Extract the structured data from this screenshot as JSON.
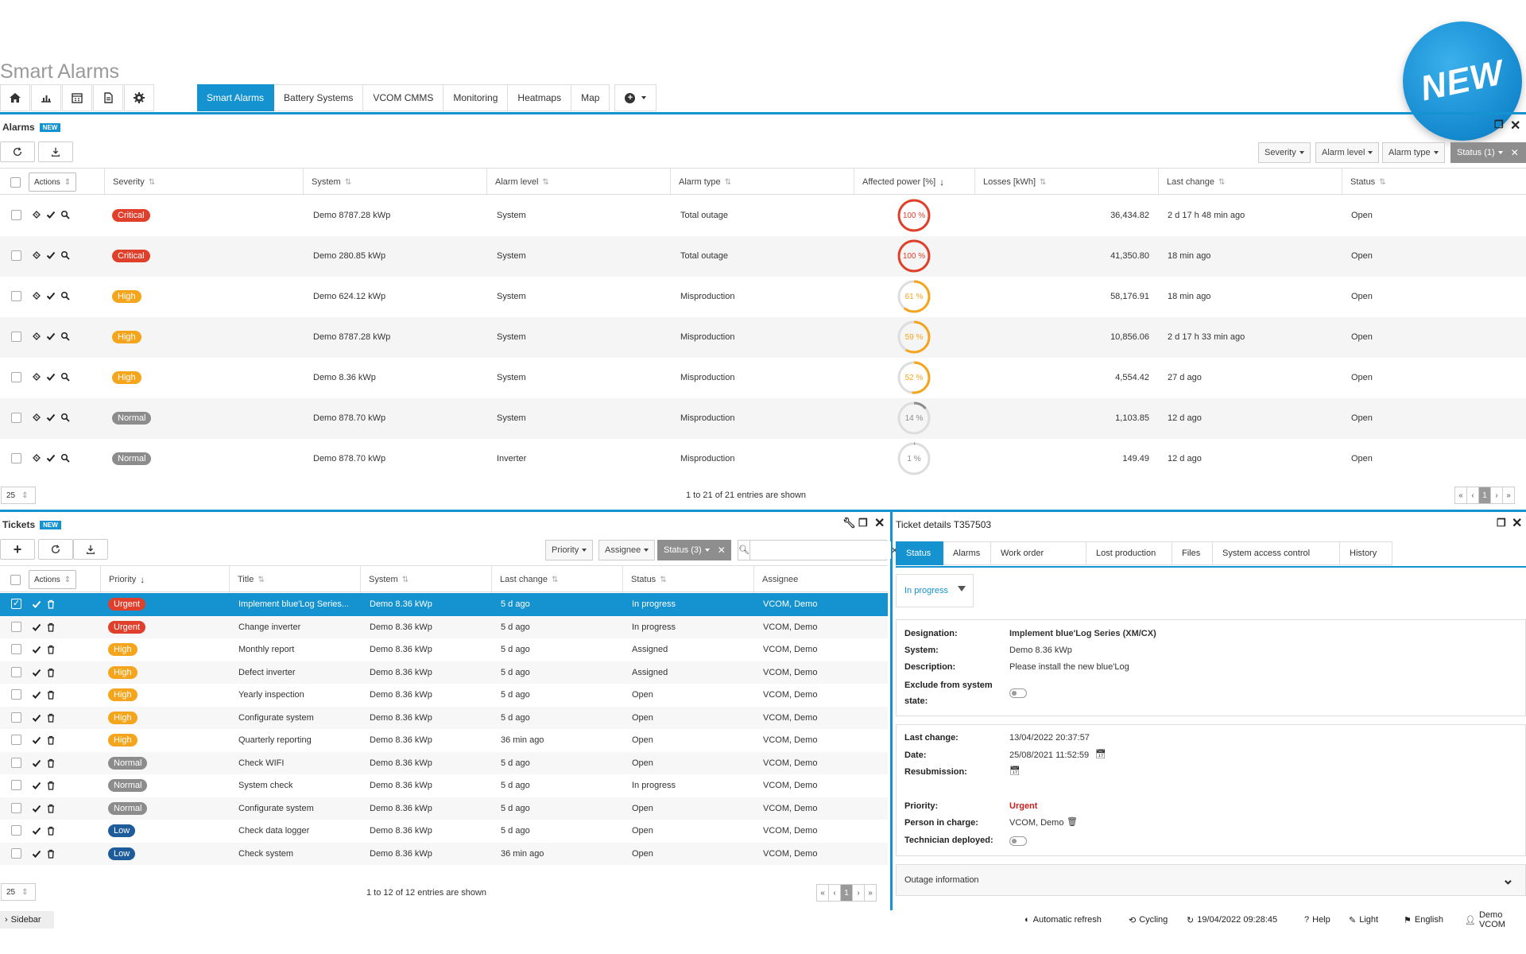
{
  "app": {
    "title": "Smart Alarms"
  },
  "nav_icons": [
    "home-icon",
    "chart-icon",
    "calendar-icon",
    "document-icon",
    "gear-icon"
  ],
  "tabs": [
    "Smart Alarms",
    "Battery Systems",
    "VCOM CMMS",
    "Monitoring",
    "Heatmaps",
    "Map"
  ],
  "new_badge": "NEW",
  "new_sticker": "NEW",
  "alarms": {
    "title": "Alarms",
    "badge": "NEW",
    "filters": [
      "Severity",
      "Alarm level",
      "Alarm type",
      "Status (1)"
    ],
    "actions_label": "Actions",
    "columns": [
      "Severity",
      "System",
      "Alarm level",
      "Alarm type",
      "Affected power [%]",
      "Losses [kWh]",
      "Last change",
      "Status"
    ],
    "rows": [
      {
        "severity": "Critical",
        "system": "Demo 8787.28 kWp",
        "level": "System",
        "type": "Total outage",
        "power": 100,
        "power_label": "100 %",
        "losses": "36,434.82",
        "last_change": "2 d 17 h 48 min ago",
        "status": "Open"
      },
      {
        "severity": "Critical",
        "system": "Demo 280.85 kWp",
        "level": "System",
        "type": "Total outage",
        "power": 100,
        "power_label": "100 %",
        "losses": "41,350.80",
        "last_change": "18 min ago",
        "status": "Open"
      },
      {
        "severity": "High",
        "system": "Demo 624.12 kWp",
        "level": "System",
        "type": "Misproduction",
        "power": 61,
        "power_label": "61 %",
        "losses": "58,176.91",
        "last_change": "18 min ago",
        "status": "Open"
      },
      {
        "severity": "High",
        "system": "Demo 8787.28 kWp",
        "level": "System",
        "type": "Misproduction",
        "power": 59,
        "power_label": "59 %",
        "losses": "10,856.06",
        "last_change": "2 d 17 h 33 min ago",
        "status": "Open"
      },
      {
        "severity": "High",
        "system": "Demo 8.36 kWp",
        "level": "System",
        "type": "Misproduction",
        "power": 52,
        "power_label": "52 %",
        "losses": "4,554.42",
        "last_change": "27 d ago",
        "status": "Open"
      },
      {
        "severity": "Normal",
        "system": "Demo 878.70 kWp",
        "level": "System",
        "type": "Misproduction",
        "power": 14,
        "power_label": "14 %",
        "losses": "1,103.85",
        "last_change": "12 d ago",
        "status": "Open"
      },
      {
        "severity": "Normal",
        "system": "Demo 878.70 kWp",
        "level": "Inverter",
        "type": "Misproduction",
        "power": 1,
        "power_label": "1 %",
        "losses": "149.49",
        "last_change": "12 d ago",
        "status": "Open"
      }
    ],
    "page_size": "25",
    "entries": "1 to 21 of 21 entries are shown",
    "pager": [
      "«",
      "‹",
      "1",
      "›",
      "»"
    ]
  },
  "tickets": {
    "title": "Tickets",
    "badge": "NEW",
    "filters": [
      "Priority",
      "Assignee",
      "Status (3)"
    ],
    "actions_label": "Actions",
    "columns": [
      "Priority",
      "Title",
      "System",
      "Last change",
      "Status",
      "Assignee"
    ],
    "rows": [
      {
        "priority": "Urgent",
        "title": "Implement blue'Log Series...",
        "system": "Demo 8.36 kWp",
        "last_change": "5 d ago",
        "status": "In progress",
        "assignee": "VCOM, Demo",
        "selected": true
      },
      {
        "priority": "Urgent",
        "title": "Change inverter",
        "system": "Demo 8.36 kWp",
        "last_change": "5 d ago",
        "status": "In progress",
        "assignee": "VCOM, Demo"
      },
      {
        "priority": "High",
        "title": "Monthly report",
        "system": "Demo 8.36 kWp",
        "last_change": "5 d ago",
        "status": "Assigned",
        "assignee": "VCOM, Demo"
      },
      {
        "priority": "High",
        "title": "Defect inverter",
        "system": "Demo 8.36 kWp",
        "last_change": "5 d ago",
        "status": "Assigned",
        "assignee": "VCOM, Demo"
      },
      {
        "priority": "High",
        "title": "Yearly inspection",
        "system": "Demo 8.36 kWp",
        "last_change": "5 d ago",
        "status": "Open",
        "assignee": "VCOM, Demo"
      },
      {
        "priority": "High",
        "title": "Configurate system",
        "system": "Demo 8.36 kWp",
        "last_change": "5 d ago",
        "status": "Open",
        "assignee": "VCOM, Demo"
      },
      {
        "priority": "High",
        "title": "Quarterly reporting",
        "system": "Demo 8.36 kWp",
        "last_change": "36 min ago",
        "status": "Open",
        "assignee": "VCOM, Demo"
      },
      {
        "priority": "Normal",
        "title": "Check WIFI",
        "system": "Demo 8.36 kWp",
        "last_change": "5 d ago",
        "status": "Open",
        "assignee": "VCOM, Demo"
      },
      {
        "priority": "Normal",
        "title": "System check",
        "system": "Demo 8.36 kWp",
        "last_change": "5 d ago",
        "status": "In progress",
        "assignee": "VCOM, Demo"
      },
      {
        "priority": "Normal",
        "title": "Configurate system",
        "system": "Demo 8.36 kWp",
        "last_change": "5 d ago",
        "status": "Open",
        "assignee": "VCOM, Demo"
      },
      {
        "priority": "Low",
        "title": "Check data logger",
        "system": "Demo 8.36 kWp",
        "last_change": "5 d ago",
        "status": "Open",
        "assignee": "VCOM, Demo"
      },
      {
        "priority": "Low",
        "title": "Check system",
        "system": "Demo 8.36 kWp",
        "last_change": "36 min ago",
        "status": "Open",
        "assignee": "VCOM, Demo"
      }
    ],
    "page_size": "25",
    "entries": "1 to 12 of 12 entries are shown",
    "pager": [
      "«",
      "‹",
      "1",
      "›",
      "»"
    ]
  },
  "details": {
    "title": "Ticket details T357503",
    "tabs": [
      "Status",
      "Alarms",
      "Work order",
      "Lost production",
      "Files",
      "System access control",
      "History"
    ],
    "status_value": "In progress",
    "fields": {
      "designation_label": "Designation:",
      "designation": "Implement blue'Log Series (XM/CX)",
      "system_label": "System:",
      "system": "Demo 8.36 kWp",
      "description_label": "Description:",
      "description": "Please install the new blue'Log",
      "exclude_label_1": "Exclude from system",
      "exclude_label_2": "state:",
      "last_change_label": "Last change:",
      "last_change": "13/04/2022 20:37:57",
      "date_label": "Date:",
      "date": "25/08/2021 11:52:59",
      "resubmission_label": "Resubmission:",
      "priority_label": "Priority:",
      "priority": "Urgent",
      "person_label": "Person in charge:",
      "person": "VCOM, Demo",
      "technician_label": "Technician deployed:"
    },
    "outage": "Outage information"
  },
  "statusbar": {
    "sidebar": "Sidebar",
    "auto_refresh": "Automatic refresh",
    "cycling": "Cycling",
    "datetime": "19/04/2022 09:28:45",
    "help": "Help",
    "light": "Light",
    "language": "English",
    "user": "Demo VCOM"
  },
  "colors": {
    "accent": "#1593d0",
    "critical": "#e0402b",
    "high": "#f5a51c",
    "normal": "#8c8c8c",
    "low": "#1e5b9a"
  }
}
